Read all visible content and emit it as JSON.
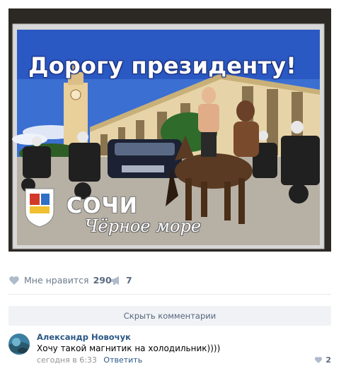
{
  "post": {
    "photo": {
      "card_title": "Дорогу президенту!",
      "city": "СОЧИ",
      "sea": "Чёрное море"
    },
    "actions": {
      "like_label": "Мне нравится",
      "like_count": "290",
      "share_count": "7"
    },
    "hide_comments_label": "Скрыть комментарии"
  },
  "comment": {
    "author": "Александр Новочук",
    "text": "Хочу такой магнитик на холодильник))))",
    "time": "сегодня в 6:33",
    "reply_label": "Ответить",
    "like_count": "2"
  },
  "colors": {
    "link": "#2a5885",
    "muted": "#939393",
    "action": "#6b7a8d",
    "button_bg": "#f0f2f5"
  },
  "icons": [
    "heart-icon",
    "megaphone-icon",
    "coat-of-arms-icon"
  ]
}
